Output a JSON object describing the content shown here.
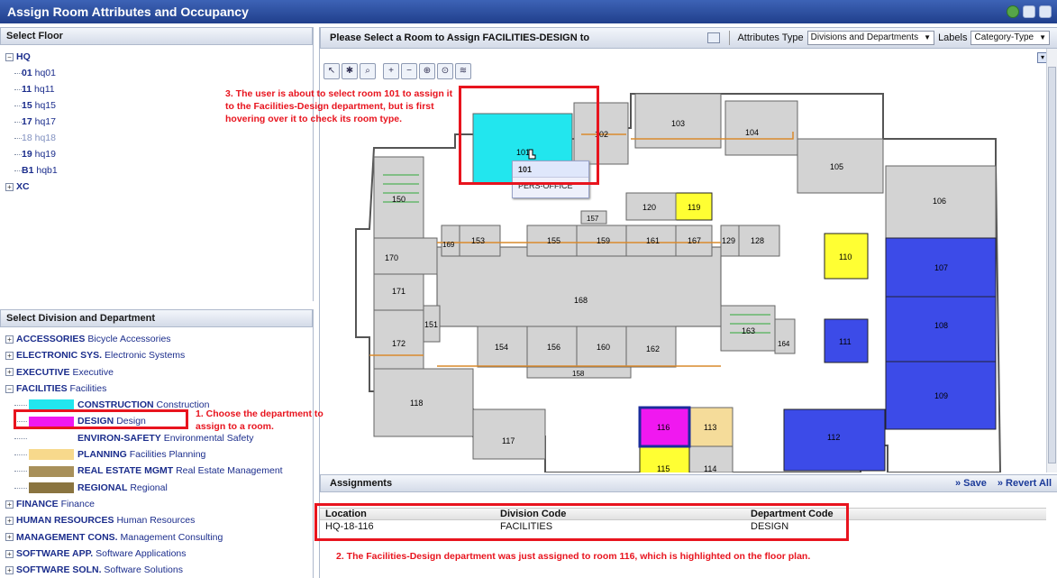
{
  "window": {
    "title": "Assign Room Attributes and Occupancy"
  },
  "floor_panel": {
    "title": "Select Floor",
    "root": "HQ",
    "floors": [
      {
        "code": "01",
        "name": "hq01",
        "dim": false
      },
      {
        "code": "11",
        "name": "hq11",
        "dim": false
      },
      {
        "code": "15",
        "name": "hq15",
        "dim": false
      },
      {
        "code": "17",
        "name": "hq17",
        "dim": false
      },
      {
        "code": "18",
        "name": "hq18",
        "dim": true
      },
      {
        "code": "19",
        "name": "hq19",
        "dim": false
      },
      {
        "code": "B1",
        "name": "hqb1",
        "dim": false
      }
    ],
    "other_root": "XC"
  },
  "dept_panel": {
    "title": "Select Division and Department",
    "top_divisions": [
      {
        "code": "ACCESSORIES",
        "name": "Bicycle Accessories"
      },
      {
        "code": "ELECTRONIC SYS.",
        "name": "Electronic Systems"
      },
      {
        "code": "EXECUTIVE",
        "name": "Executive"
      }
    ],
    "facilities": {
      "code": "FACILITIES",
      "name": "Facilities"
    },
    "departments": [
      {
        "code": "CONSTRUCTION",
        "name": "Construction",
        "color": "#22e6ee"
      },
      {
        "code": "DESIGN",
        "name": "Design",
        "color": "#f018f0"
      },
      {
        "code": "ENVIRON-SAFETY",
        "name": "Environmental Safety",
        "color": ""
      },
      {
        "code": "PLANNING",
        "name": "Facilities Planning",
        "color": "#f7d98c"
      },
      {
        "code": "REAL ESTATE MGMT",
        "name": "Real Estate Management",
        "color": "#a8905a"
      },
      {
        "code": "REGIONAL",
        "name": "Regional",
        "color": "#8a7440"
      }
    ],
    "bottom_divisions": [
      {
        "code": "FINANCE",
        "name": "Finance"
      },
      {
        "code": "HUMAN RESOURCES",
        "name": "Human Resources"
      },
      {
        "code": "MANAGEMENT CONS.",
        "name": "Management Consulting"
      },
      {
        "code": "SOFTWARE APP.",
        "name": "Software Applications"
      },
      {
        "code": "SOFTWARE SOLN.",
        "name": "Software Solutions"
      }
    ]
  },
  "map_panel": {
    "title": "Please Select a Room to Assign FACILITIES-DESIGN to",
    "attributes_label": "Attributes Type",
    "attributes_value": "Divisions and Departments",
    "labels_label": "Labels",
    "labels_value": "Category-Type",
    "tooltip": {
      "room": "101",
      "type": "PERS-OFFICE"
    }
  },
  "rooms": {
    "r101": "101",
    "r102": "102",
    "r103": "103",
    "r104": "104",
    "r105": "105",
    "r106": "106",
    "r107": "107",
    "r108": "108",
    "r109": "109",
    "r110": "110",
    "r111": "111",
    "r112": "112",
    "r113": "113",
    "r114": "114",
    "r115": "115",
    "r116": "116",
    "r117": "117",
    "r118": "118",
    "r119": "119",
    "r120": "120",
    "r128": "128",
    "r129": "129",
    "r150": "150",
    "r151": "151",
    "r153": "153",
    "r154": "154",
    "r155": "155",
    "r156": "156",
    "r157": "157",
    "r158": "158",
    "r159": "159",
    "r160": "160",
    "r161": "161",
    "r162": "162",
    "r163": "163",
    "r164": "164",
    "r167": "167",
    "r168": "168",
    "r169": "169",
    "r170": "170",
    "r171": "171",
    "r172": "172"
  },
  "colors": {
    "construction": "#22e6ee",
    "design": "#f018f0",
    "yellow": "#ffff33",
    "tan": "#f5dc9a",
    "blue": "#3c4be8",
    "gray": "#d3d3d3",
    "annotation": "#e8141e"
  },
  "assignments": {
    "title": "Assignments",
    "save_label": "» Save",
    "revert_label": "» Revert All",
    "columns": [
      "Location",
      "Division Code",
      "Department Code"
    ],
    "rows": [
      {
        "location": "HQ-18-116",
        "division": "FACILITIES",
        "department": "DESIGN"
      }
    ]
  },
  "annotations": {
    "note1_line1": "1. Choose the department to",
    "note1_line2": "assign to a room.",
    "note2": "2. The Facilities-Design department was just assigned to room 116, which is highlighted on the floor plan.",
    "note3_line1": "3. The user is about to select room 101 to assign it",
    "note3_line2": "to the Facilities-Design department, but is first",
    "note3_line3": "hovering over it to check its room type."
  }
}
